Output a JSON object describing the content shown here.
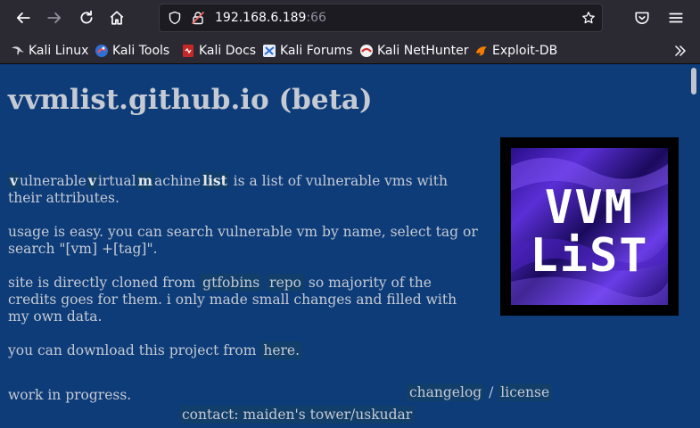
{
  "browser": {
    "url_host": "192.168.6.189",
    "url_port": ":66",
    "bookmarks": [
      {
        "label": "Kali Linux",
        "icon": "kali-dragon-icon"
      },
      {
        "label": "Kali Tools",
        "icon": "kali-tools-icon"
      },
      {
        "label": "Kali Docs",
        "icon": "kali-docs-icon"
      },
      {
        "label": "Kali Forums",
        "icon": "kali-forums-icon"
      },
      {
        "label": "Kali NetHunter",
        "icon": "nethunter-icon"
      },
      {
        "label": "Exploit-DB",
        "icon": "exploit-db-icon"
      }
    ]
  },
  "page": {
    "title": "vvmlist.github.io (beta)",
    "intro": {
      "w1_initial": "v",
      "w1_rest": "ulnerable",
      "w2_initial": "v",
      "w2_rest": "irtual",
      "w3_initial": "m",
      "w3_rest": "achine",
      "w4": "list",
      "tail": " is a list of vulnerable vms with their attributes."
    },
    "usage": "usage is easy. you can search vulnerable vm by name, select tag or search \"[vm] +[tag]\".",
    "clone": {
      "prefix": "site is directly cloned from ",
      "link1": "gtfobins",
      "link2": "repo",
      "suffix": " so majority of the credits goes for them. i only made small changes and filled with my own data."
    },
    "download": {
      "prefix": "you can download this project from ",
      "link": "here."
    },
    "wip": "work in progress.",
    "changelog": "changelog",
    "sep": " / ",
    "license": "license",
    "contact": "contact: maiden's tower/uskudar",
    "logo_text_top": "VVM",
    "logo_text_bottom": "LiST"
  },
  "colors": {
    "page_bg": "#0d3c79",
    "text": "#c5cad3",
    "chrome_bg": "#2b2a33"
  }
}
